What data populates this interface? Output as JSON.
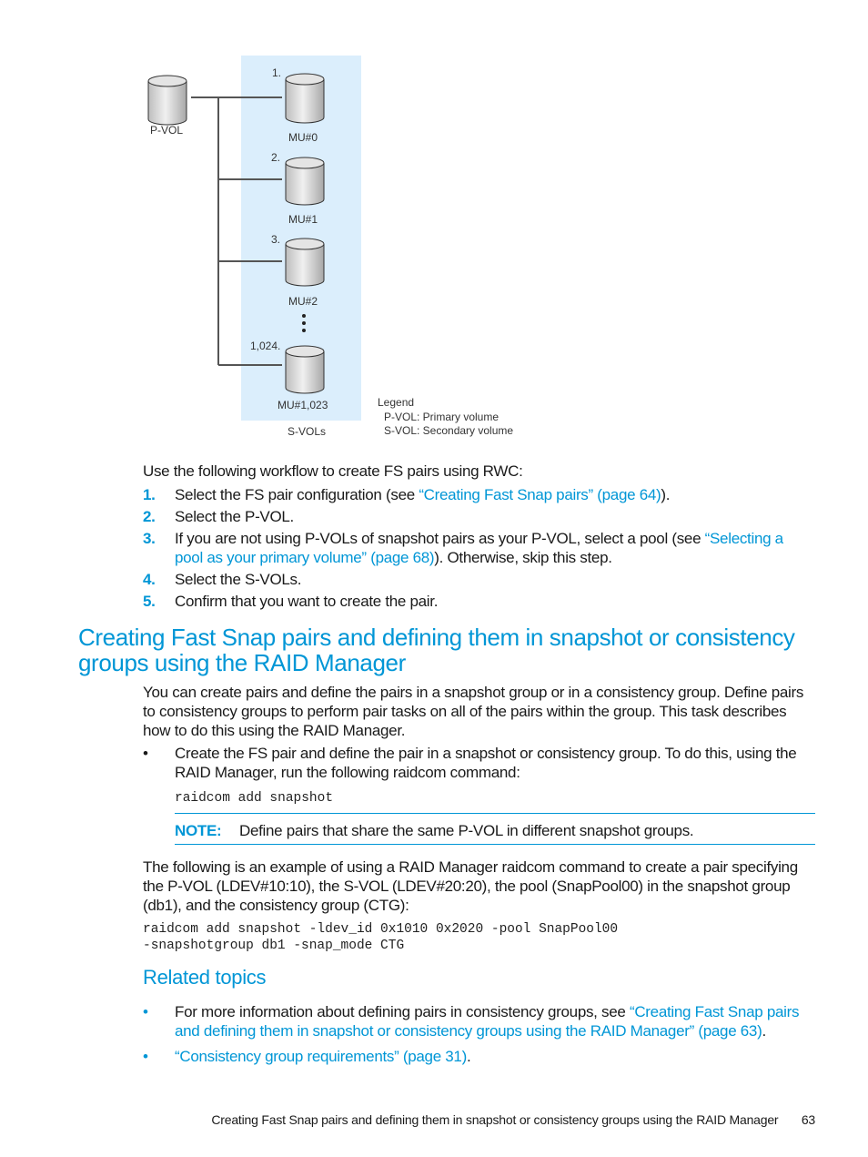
{
  "diagram": {
    "pvol_label": "P-VOL",
    "svols_label": "S-VOLs",
    "svols": [
      {
        "index": "1.",
        "label": "MU#0"
      },
      {
        "index": "2.",
        "label": "MU#1"
      },
      {
        "index": "3.",
        "label": "MU#2"
      },
      {
        "index": "1,024.",
        "label": "MU#1,023"
      }
    ],
    "legend": {
      "title": "Legend",
      "items": [
        "P-VOL: Primary volume",
        "S-VOL: Secondary volume"
      ]
    },
    "colors": {
      "svol_area": "#dbeefc",
      "cylinder_fill": "#d8d8d8",
      "line": "#555555"
    }
  },
  "workflow": {
    "intro": "Use the following workflow to create FS pairs using RWC:",
    "steps": [
      {
        "num": "1.",
        "text_before": "Select the FS pair configuration (see ",
        "link": "“Creating Fast Snap pairs” (page 64)",
        "text_after": ")."
      },
      {
        "num": "2.",
        "text_before": "Select the P-VOL.",
        "link": "",
        "text_after": ""
      },
      {
        "num": "3.",
        "text_before": "If you are not using P-VOLs of snapshot pairs as your P-VOL, select a pool (see ",
        "link": "“Selecting a pool as your primary volume” (page 68)",
        "text_after": "). Otherwise, skip this step."
      },
      {
        "num": "4.",
        "text_before": "Select the S-VOLs.",
        "link": "",
        "text_after": ""
      },
      {
        "num": "5.",
        "text_before": "Confirm that you want to create the pair.",
        "link": "",
        "text_after": ""
      }
    ]
  },
  "section": {
    "heading": "Creating Fast Snap pairs and defining them in snapshot or consistency groups using the RAID Manager",
    "paragraph": "You can create pairs and define the pairs in a snapshot group or in a consistency group. Define pairs to consistency groups to perform pair tasks on all of the pairs within the group. This task describes how to do this using the RAID Manager.",
    "bullet_text": "Create the FS pair and define the pair in a snapshot or consistency group. To do this, using the RAID Manager, run the following raidcom command:",
    "command": "raidcom add snapshot",
    "note_label": "NOTE:",
    "note_text": "Define pairs that share the same P-VOL in different snapshot groups.",
    "example_text": "The following is an example of using a RAID Manager raidcom command to create a pair specifying the P-VOL (LDEV#10:10), the S-VOL (LDEV#20:20), the pool (SnapPool00) in the snapshot group (db1), and the consistency group (CTG):",
    "example_command_line1": "raidcom add snapshot -ldev_id 0x1010 0x2020 -pool SnapPool00",
    "example_command_line2": "-snapshotgroup db1 -snap_mode CTG"
  },
  "related": {
    "heading": "Related topics",
    "items": [
      {
        "text_before": "For more information about defining pairs in consistency groups, see ",
        "link": "“Creating Fast Snap pairs and defining them in snapshot or consistency groups using the RAID Manager” (page 63)",
        "text_after": "."
      },
      {
        "text_before": "",
        "link": "“Consistency group requirements” (page 31)",
        "text_after": "."
      }
    ]
  },
  "footer": {
    "running_title": "Creating Fast Snap pairs and defining them in snapshot or consistency groups using the RAID Manager",
    "page_number": "63"
  },
  "accent_color": "#0096d6"
}
